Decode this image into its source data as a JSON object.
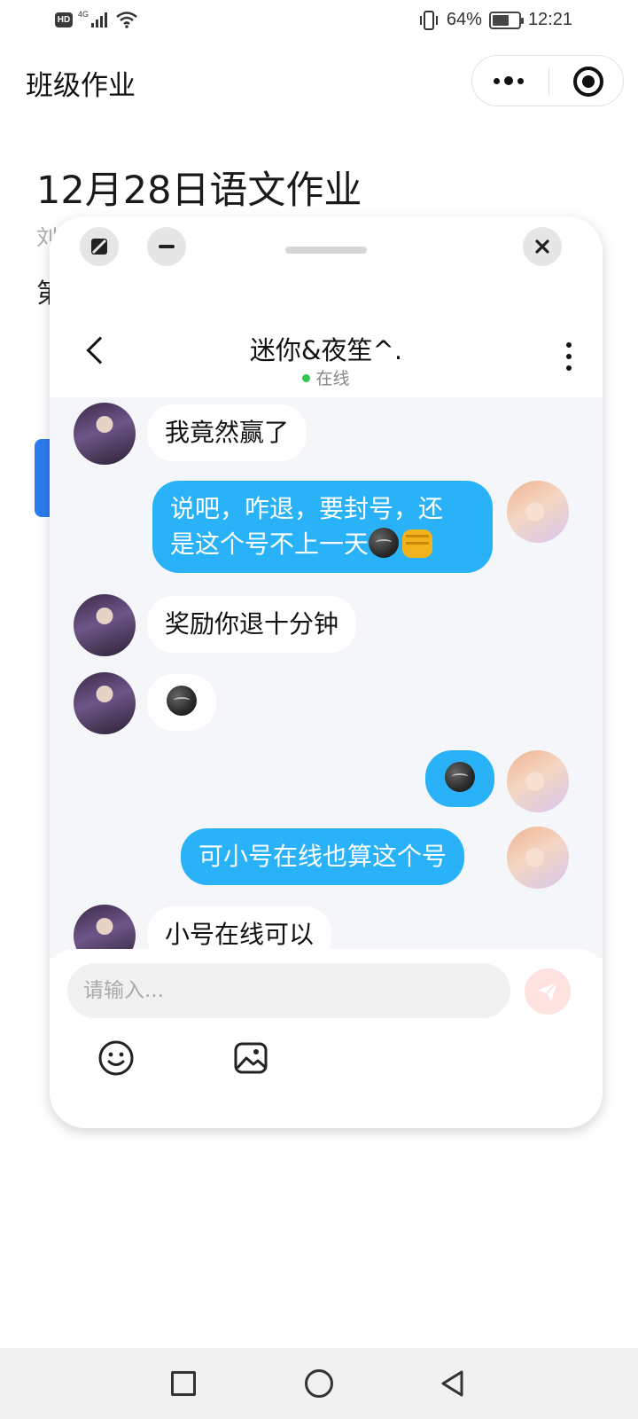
{
  "status_bar": {
    "hd": "HD",
    "network": "4G",
    "battery": "64%",
    "battery_level": 0.64,
    "time": "12:21"
  },
  "app": {
    "title": "班级作业",
    "heading": "12月28日语文作业",
    "author_peek": "刘",
    "line_peek": "第"
  },
  "chat": {
    "name": "迷你&夜笙^.",
    "status": "在线",
    "messages": [
      {
        "side": "left",
        "text": "我竟然赢了"
      },
      {
        "side": "right",
        "text": "说吧，咋退，要封号，还是这个号不上一天",
        "emojis": [
          "smirk-emoji",
          "fist-emoji"
        ]
      },
      {
        "side": "left",
        "text": "奖励你退十分钟"
      },
      {
        "side": "left",
        "text": "",
        "emojis": [
          "smirk-emoji"
        ]
      },
      {
        "side": "right",
        "text": "",
        "emojis": [
          "smirk-emoji"
        ]
      },
      {
        "side": "right",
        "text": "可小号在线也算这个号"
      },
      {
        "side": "left",
        "text": "小号在线可以"
      }
    ],
    "message_lines": {
      "m2_line1": "说吧，咋退，要封号，还",
      "m2_line2": "是这个号不上一天"
    },
    "input_placeholder": "请输入...",
    "icons": [
      "smile-icon",
      "image-icon",
      "send-icon"
    ]
  },
  "colors": {
    "bubble_right": "#2ab2f8",
    "bubble_left": "#ffffff",
    "chat_bg": "#f4f6f9",
    "online": "#2ec94a",
    "accent": "#2b7cf0"
  }
}
